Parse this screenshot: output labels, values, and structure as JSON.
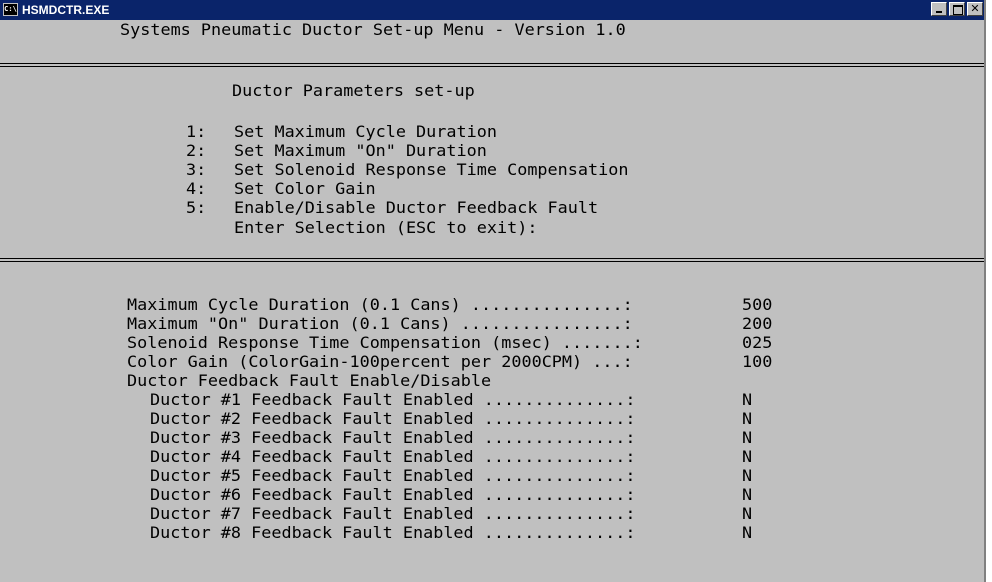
{
  "window": {
    "title": "HSMDCTR.EXE",
    "icon": "console-icon",
    "icon_text": "C:\\"
  },
  "header": {
    "title": "Systems Pneumatic Ductor Set-up Menu - Version 1.0"
  },
  "menu": {
    "heading": "Ductor Parameters set-up",
    "items": [
      {
        "number": "1:",
        "label": "Set Maximum Cycle Duration"
      },
      {
        "number": "2:",
        "label": "Set Maximum \"On\" Duration"
      },
      {
        "number": "3:",
        "label": "Set Solenoid Response Time Compensation"
      },
      {
        "number": "4:",
        "label": "Set Color Gain"
      },
      {
        "number": "5:",
        "label": "Enable/Disable Ductor Feedback Fault"
      }
    ],
    "prompt": "Enter Selection (ESC to exit):"
  },
  "status": {
    "params": [
      {
        "label": "Maximum Cycle Duration (0.1 Cans) ...............:",
        "value": "500"
      },
      {
        "label": "Maximum \"On\" Duration (0.1 Cans) ................:",
        "value": "200"
      },
      {
        "label": "Solenoid Response Time Compensation (msec) .......:",
        "value": "025"
      },
      {
        "label": "Color Gain (ColorGain-100percent per 2000CPM) ...:",
        "value": "100"
      }
    ],
    "fault_heading": "Ductor Feedback Fault Enable/Disable",
    "faults": [
      {
        "label": "Ductor #1 Feedback Fault Enabled ..............:",
        "value": "N"
      },
      {
        "label": "Ductor #2 Feedback Fault Enabled ..............:",
        "value": "N"
      },
      {
        "label": "Ductor #3 Feedback Fault Enabled ..............:",
        "value": "N"
      },
      {
        "label": "Ductor #4 Feedback Fault Enabled ..............:",
        "value": "N"
      },
      {
        "label": "Ductor #5 Feedback Fault Enabled ..............:",
        "value": "N"
      },
      {
        "label": "Ductor #6 Feedback Fault Enabled ..............:",
        "value": "N"
      },
      {
        "label": "Ductor #7 Feedback Fault Enabled ..............:",
        "value": "N"
      },
      {
        "label": "Ductor #8 Feedback Fault Enabled ..............:",
        "value": "N"
      }
    ]
  },
  "colors": {
    "titlebar": "#0a246a",
    "console_background": "#c0c0c0",
    "console_text": "#000000"
  }
}
